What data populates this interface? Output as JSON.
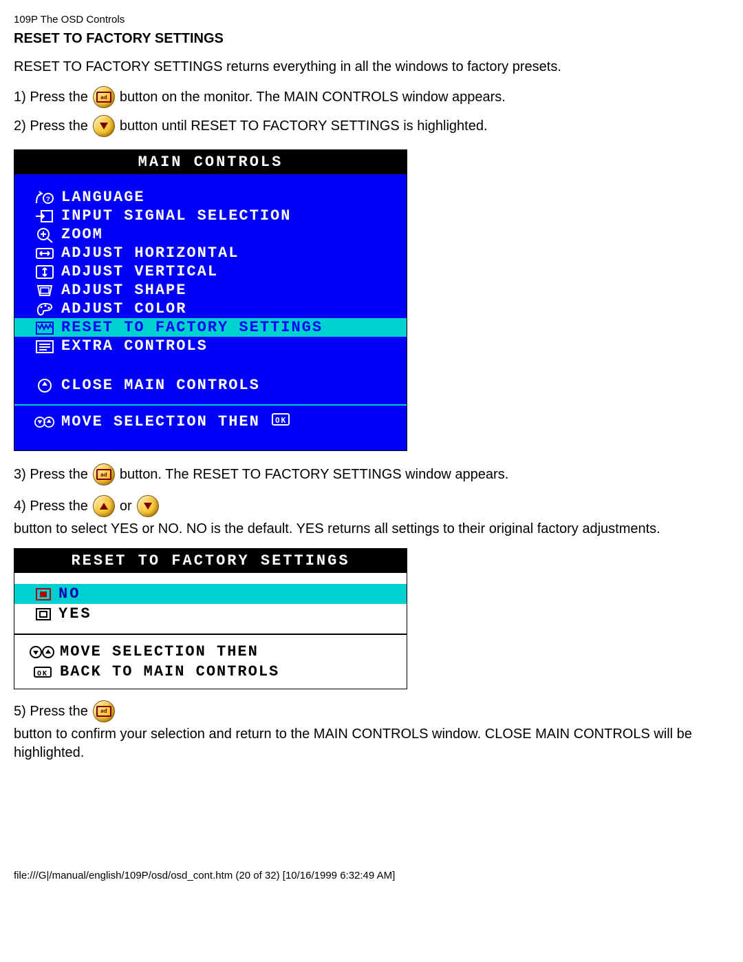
{
  "header": "109P The OSD Controls",
  "section_title": "RESET TO FACTORY SETTINGS",
  "intro": "RESET TO FACTORY SETTINGS returns everything in all the windows to factory presets.",
  "step1_a": "1) Press the",
  "step1_b": "button on the monitor. The MAIN CONTROLS window appears.",
  "step2_a": "2) Press the",
  "step2_b": "button until RESET TO FACTORY SETTINGS is highlighted.",
  "osd1": {
    "title": "MAIN CONTROLS",
    "items": {
      "language": "LANGUAGE",
      "input": "INPUT SIGNAL SELECTION",
      "zoom": "ZOOM",
      "adj_h": "ADJUST HORIZONTAL",
      "adj_v": "ADJUST VERTICAL",
      "adj_shape": "ADJUST SHAPE",
      "adj_color": "ADJUST COLOR",
      "reset": "RESET TO FACTORY SETTINGS",
      "extra": "EXTRA CONTROLS",
      "close": "CLOSE MAIN CONTROLS"
    },
    "footer": "MOVE SELECTION THEN"
  },
  "step3_a": "3) Press the",
  "step3_b": "button. The RESET TO FACTORY SETTINGS window appears.",
  "step4_a": "4) Press the",
  "step4_b": "or",
  "step4_c": "button to select YES or NO. NO is the default. YES returns all settings to their original factory adjustments.",
  "osd2": {
    "title": "RESET TO FACTORY SETTINGS",
    "no": "NO",
    "yes": "YES",
    "footer1": "MOVE SELECTION THEN",
    "footer2": "BACK TO MAIN CONTROLS"
  },
  "step5_a": "5) Press the",
  "step5_b": "button to confirm your selection and return to the MAIN CONTROLS window. CLOSE MAIN CONTROLS will be highlighted.",
  "page_footer": "file:///G|/manual/english/109P/osd/osd_cont.htm (20 of 32) [10/16/1999 6:32:49 AM]"
}
